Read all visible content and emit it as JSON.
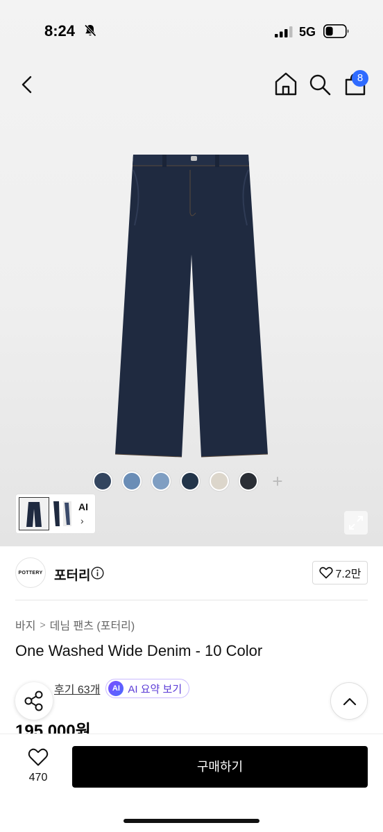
{
  "status_bar": {
    "time": "8:24",
    "network": "5G"
  },
  "nav": {
    "cart_count": "8"
  },
  "swatches": [
    "#33455f",
    "#6a8db6",
    "#7f9ec2",
    "#23354a",
    "#dcd6cb",
    "#2a2e35"
  ],
  "swatch_add": "+",
  "thumbnail": {
    "ai_label": "AI",
    "chevron": "›"
  },
  "brand": {
    "logo_text": "POTTERY",
    "name": "포터리",
    "likes": "7.2만"
  },
  "breadcrumb": {
    "category": "바지",
    "subcategory": "데님 팬츠 (포터리)",
    "separator": ">"
  },
  "product": {
    "title": "One Washed Wide Denim - 10 Color",
    "reviews": "후기 63개",
    "ai_badge": "AI",
    "ai_summary": "AI 요약 보기",
    "price": "195,000원"
  },
  "bottom_bar": {
    "wish_count": "470",
    "buy_label": "구매하기"
  },
  "colors": {
    "accent": "#2f6bff",
    "ai_purple": "#5a3ad6",
    "denim": "#1f2a40"
  }
}
